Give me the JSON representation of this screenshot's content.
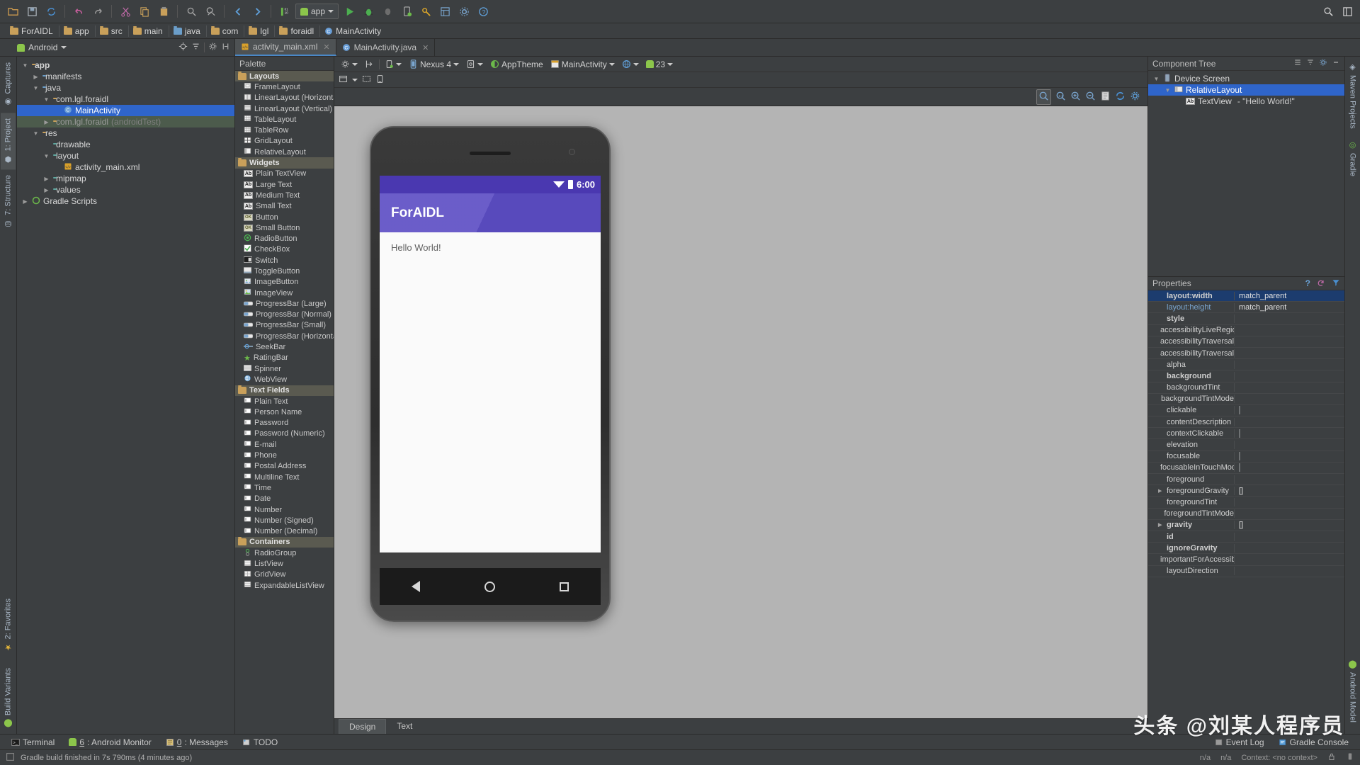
{
  "toolbar": {
    "icons": [
      "open-folder",
      "save-all",
      "sync",
      "undo",
      "redo",
      "cut",
      "copy",
      "paste",
      "find",
      "replace",
      "back",
      "forward",
      "compile"
    ],
    "run_config": "app",
    "right_icons": [
      "search",
      "layout"
    ]
  },
  "breadcrumb": [
    "ForAIDL",
    "app",
    "src",
    "main",
    "java",
    "com",
    "lgl",
    "foraidl",
    "MainActivity"
  ],
  "project": {
    "title": "Android",
    "tree": [
      {
        "label": "app",
        "indent": 0,
        "arrow": "down",
        "icon": "module-folder",
        "bold": true
      },
      {
        "label": "manifests",
        "indent": 1,
        "arrow": "right",
        "icon": "folder-blue"
      },
      {
        "label": "java",
        "indent": 1,
        "arrow": "down",
        "icon": "folder-blue"
      },
      {
        "label": "com.lgl.foraidl",
        "indent": 2,
        "arrow": "down",
        "icon": "package-folder"
      },
      {
        "label": "MainActivity",
        "indent": 3,
        "arrow": "",
        "icon": "class-icon",
        "selected": true
      },
      {
        "label": "com.lgl.foraidl",
        "suffix": "(androidTest)",
        "indent": 2,
        "arrow": "right",
        "icon": "package-folder",
        "greenrow": true
      },
      {
        "label": "res",
        "indent": 1,
        "arrow": "down",
        "icon": "res-folder"
      },
      {
        "label": "drawable",
        "indent": 2,
        "arrow": "",
        "icon": "folder-teal"
      },
      {
        "label": "layout",
        "indent": 2,
        "arrow": "down",
        "icon": "folder-teal"
      },
      {
        "label": "activity_main.xml",
        "indent": 3,
        "arrow": "",
        "icon": "xml-file"
      },
      {
        "label": "mipmap",
        "indent": 2,
        "arrow": "right",
        "icon": "folder-teal"
      },
      {
        "label": "values",
        "indent": 2,
        "arrow": "right",
        "icon": "folder-teal"
      },
      {
        "label": "Gradle Scripts",
        "indent": 0,
        "arrow": "right",
        "icon": "gradle-icon"
      }
    ]
  },
  "left_strip": [
    "Captures",
    "1: Project",
    "7: Structure",
    "2: Favorites",
    "Build Variants"
  ],
  "right_strip": [
    "Maven Projects",
    "Gradle",
    "Android Model"
  ],
  "editor_tabs": [
    {
      "label": "activity_main.xml",
      "icon": "xml-file",
      "active": true
    },
    {
      "label": "MainActivity.java",
      "icon": "class-icon",
      "active": false
    }
  ],
  "palette": {
    "title": "Palette",
    "groups": [
      {
        "name": "Layouts",
        "items": [
          {
            "label": "FrameLayout",
            "icon": "frame-layout-icon"
          },
          {
            "label": "LinearLayout (Horizontal)",
            "icon": "linear-h-icon"
          },
          {
            "label": "LinearLayout (Vertical)",
            "icon": "linear-v-icon"
          },
          {
            "label": "TableLayout",
            "icon": "table-layout-icon"
          },
          {
            "label": "TableRow",
            "icon": "table-row-icon"
          },
          {
            "label": "GridLayout",
            "icon": "grid-layout-icon"
          },
          {
            "label": "RelativeLayout",
            "icon": "relative-layout-icon"
          }
        ]
      },
      {
        "name": "Widgets",
        "items": [
          {
            "label": "Plain TextView",
            "icon": "ab-icon"
          },
          {
            "label": "Large Text",
            "icon": "ab-icon"
          },
          {
            "label": "Medium Text",
            "icon": "ab-icon"
          },
          {
            "label": "Small Text",
            "icon": "ab-icon"
          },
          {
            "label": "Button",
            "icon": "ok-icon"
          },
          {
            "label": "Small Button",
            "icon": "ok-icon"
          },
          {
            "label": "RadioButton",
            "icon": "radio-icon"
          },
          {
            "label": "CheckBox",
            "icon": "check-icon"
          },
          {
            "label": "Switch",
            "icon": "switch-icon"
          },
          {
            "label": "ToggleButton",
            "icon": "toggle-icon"
          },
          {
            "label": "ImageButton",
            "icon": "image-button-icon"
          },
          {
            "label": "ImageView",
            "icon": "image-view-icon"
          },
          {
            "label": "ProgressBar (Large)",
            "icon": "progress-icon"
          },
          {
            "label": "ProgressBar (Normal)",
            "icon": "progress-icon"
          },
          {
            "label": "ProgressBar (Small)",
            "icon": "progress-icon"
          },
          {
            "label": "ProgressBar (Horizontal)",
            "icon": "progress-icon"
          },
          {
            "label": "SeekBar",
            "icon": "seekbar-icon"
          },
          {
            "label": "RatingBar",
            "icon": "star-icon"
          },
          {
            "label": "Spinner",
            "icon": "spinner-icon"
          },
          {
            "label": "WebView",
            "icon": "webview-icon"
          }
        ]
      },
      {
        "name": "Text Fields",
        "items": [
          {
            "label": "Plain Text",
            "icon": "textfield-icon"
          },
          {
            "label": "Person Name",
            "icon": "textfield-icon"
          },
          {
            "label": "Password",
            "icon": "textfield-icon"
          },
          {
            "label": "Password (Numeric)",
            "icon": "textfield-icon"
          },
          {
            "label": "E-mail",
            "icon": "textfield-icon"
          },
          {
            "label": "Phone",
            "icon": "textfield-icon"
          },
          {
            "label": "Postal Address",
            "icon": "textfield-icon"
          },
          {
            "label": "Multiline Text",
            "icon": "textfield-icon"
          },
          {
            "label": "Time",
            "icon": "textfield-icon"
          },
          {
            "label": "Date",
            "icon": "textfield-icon"
          },
          {
            "label": "Number",
            "icon": "textfield-icon"
          },
          {
            "label": "Number (Signed)",
            "icon": "textfield-icon"
          },
          {
            "label": "Number (Decimal)",
            "icon": "textfield-icon"
          }
        ]
      },
      {
        "name": "Containers",
        "items": [
          {
            "label": "RadioGroup",
            "icon": "radiogroup-icon"
          },
          {
            "label": "ListView",
            "icon": "listview-icon"
          },
          {
            "label": "GridView",
            "icon": "gridview-icon"
          },
          {
            "label": "ExpandableListView",
            "icon": "listview-icon"
          }
        ]
      }
    ]
  },
  "designer": {
    "toolbar": {
      "device": "Nexus 4",
      "theme": "AppTheme",
      "activity": "MainActivity",
      "api": "23",
      "orientation_icon": "orientation-icon",
      "locale_icon": "globe-icon",
      "settings_icon": "gear-icon",
      "constraints_icon": "constraints-icon"
    },
    "zoom_icons": [
      "zoom-fit",
      "zoom-actual",
      "zoom-in",
      "zoom-out",
      "screenshot",
      "refresh",
      "gear"
    ],
    "bottom_tabs": [
      {
        "label": "Design",
        "active": true
      },
      {
        "label": "Text",
        "active": false
      }
    ]
  },
  "preview": {
    "status_time": "6:00",
    "app_title": "ForAIDL",
    "hello_text": "Hello World!",
    "nav_icons": [
      "back-triangle",
      "home-circle",
      "recents-square"
    ]
  },
  "component_tree": {
    "title": "Component Tree",
    "header_icons": [
      "expand-all",
      "collapse-all",
      "gear-icon",
      "minimize-icon"
    ],
    "nodes": [
      {
        "label": "Device Screen",
        "indent": 0,
        "arrow": "down",
        "icon": "device-icon"
      },
      {
        "label": "RelativeLayout",
        "indent": 1,
        "arrow": "down",
        "icon": "relative-layout-icon",
        "selected": true
      },
      {
        "label": "TextView",
        "suffix": "- \"Hello World!\"",
        "indent": 2,
        "arrow": "",
        "icon": "ab-icon"
      }
    ]
  },
  "properties": {
    "title": "Properties",
    "header_icons": [
      "help-icon",
      "reset-icon",
      "filter-icon"
    ],
    "rows": [
      {
        "key": "layout:width",
        "value": "match_parent",
        "bold": true,
        "selected": true
      },
      {
        "key": "layout:height",
        "value": "match_parent",
        "blue": true
      },
      {
        "key": "style",
        "value": "",
        "bold": true
      },
      {
        "key": "accessibilityLiveRegion",
        "value": ""
      },
      {
        "key": "accessibilityTraversalA",
        "value": ""
      },
      {
        "key": "accessibilityTraversalB",
        "value": ""
      },
      {
        "key": "alpha",
        "value": ""
      },
      {
        "key": "background",
        "value": "",
        "bold": true
      },
      {
        "key": "backgroundTint",
        "value": ""
      },
      {
        "key": "backgroundTintMode",
        "value": ""
      },
      {
        "key": "clickable",
        "value": "",
        "checkbox": true
      },
      {
        "key": "contentDescription",
        "value": ""
      },
      {
        "key": "contextClickable",
        "value": "",
        "checkbox": true
      },
      {
        "key": "elevation",
        "value": ""
      },
      {
        "key": "focusable",
        "value": "",
        "checkbox": true
      },
      {
        "key": "focusableInTouchMode",
        "value": "",
        "checkbox": true
      },
      {
        "key": "foreground",
        "value": ""
      },
      {
        "key": "foregroundGravity",
        "value": "[]",
        "expand": true
      },
      {
        "key": "foregroundTint",
        "value": ""
      },
      {
        "key": "foregroundTintMode",
        "value": ""
      },
      {
        "key": "gravity",
        "value": "[]",
        "bold": true,
        "expand": true
      },
      {
        "key": "id",
        "value": "",
        "bold": true
      },
      {
        "key": "ignoreGravity",
        "value": "",
        "bold": true
      },
      {
        "key": "importantForAccessibil",
        "value": ""
      },
      {
        "key": "layoutDirection",
        "value": ""
      }
    ]
  },
  "tool_windows": [
    {
      "label": "Terminal",
      "icon": "terminal-icon",
      "num": ""
    },
    {
      "label": ": Android Monitor",
      "icon": "android-icon",
      "num": "6"
    },
    {
      "label": ": Messages",
      "icon": "messages-icon",
      "num": "0"
    },
    {
      "label": "TODO",
      "icon": "todo-icon",
      "num": ""
    }
  ],
  "tool_windows_right": [
    {
      "label": "Event Log",
      "icon": "eventlog-icon"
    },
    {
      "label": "Gradle Console",
      "icon": "gradle-console-icon"
    }
  ],
  "status": {
    "message": "Gradle build finished in 7s 790ms (4 minutes ago)",
    "right": [
      "n/a",
      "n/a",
      "Context: <no context>"
    ]
  },
  "watermark": "头条 @刘某人程序员",
  "colors": {
    "accent_blue": "#2f65ca",
    "panel_bg": "#3c3f41",
    "android_purple": "#5c4dc4",
    "status_purple": "#4a38b0"
  }
}
